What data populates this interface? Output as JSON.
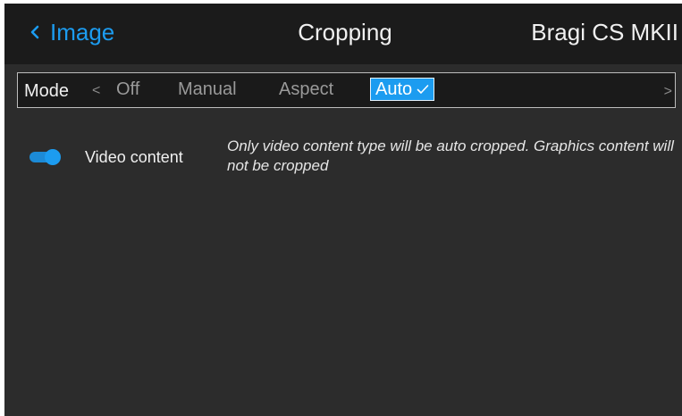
{
  "header": {
    "back_label": "Image",
    "title": "Cropping",
    "device_name": "Bragi CS MKII"
  },
  "mode": {
    "label": "Mode",
    "prev_arrow": "<",
    "next_arrow": ">",
    "options": [
      "Off",
      "Manual",
      "Aspect",
      "Auto"
    ],
    "selected": "Auto"
  },
  "setting": {
    "toggle_on": true,
    "label": "Video content",
    "description": "Only video content type will be auto cropped. Graphics content will not be cropped"
  },
  "colors": {
    "accent": "#1c9cf0",
    "header_bg": "#1b1b1b",
    "panel_bg": "#2c2c2c",
    "text": "#f0f0f0",
    "muted_text": "#9a9a9a"
  },
  "icons": {
    "back": "chevron-left-icon",
    "selected": "check-icon",
    "prev": "chevron-left-icon",
    "next": "chevron-right-icon"
  }
}
